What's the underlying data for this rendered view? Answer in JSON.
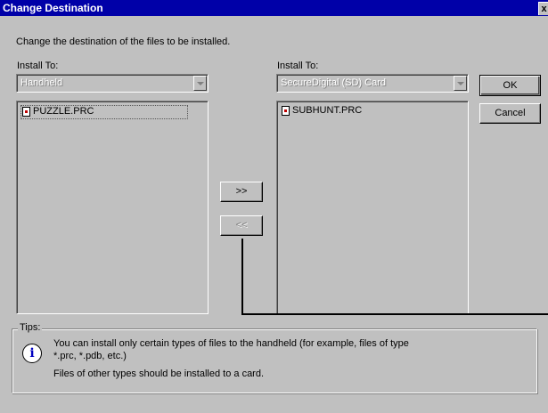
{
  "window": {
    "title": "Change Destination",
    "close_label": "x"
  },
  "intro": "Change the destination of the files to be installed.",
  "left": {
    "label": "Install To:",
    "combo_value": "Handheld",
    "files": [
      "PUZZLE.PRC"
    ]
  },
  "right": {
    "label": "Install To:",
    "combo_value": "SecureDigital (SD) Card",
    "files": [
      "SUBHUNT.PRC"
    ]
  },
  "buttons": {
    "ok": "OK",
    "cancel": "Cancel",
    "move_right": ">>",
    "move_left": "<<"
  },
  "tips": {
    "label": "Tips:",
    "icon": "info-icon",
    "line1": "You can install only certain types of files to the handheld (for example, files of type",
    "line2": "*.prc, *.pdb, etc.)",
    "line3": "Files of other types should be installed to a card."
  }
}
